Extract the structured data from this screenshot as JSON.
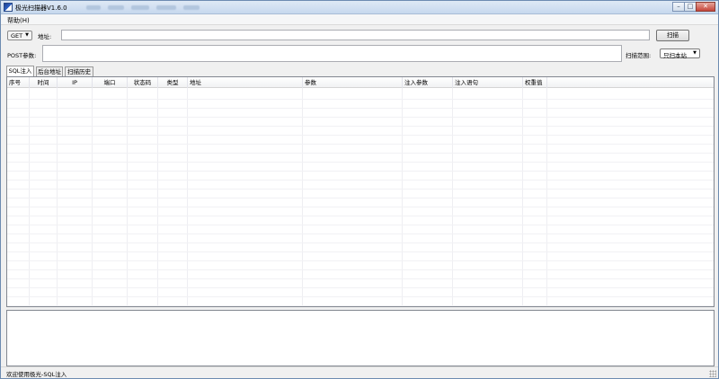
{
  "window": {
    "title": "极光扫描器V1.6.0",
    "controls": {
      "minimize": "–",
      "maximize": "□",
      "close": "✕"
    }
  },
  "menubar": {
    "items": [
      "帮助(H)"
    ]
  },
  "request": {
    "method": "GET",
    "url_label": "地址:",
    "url_value": "",
    "post_label": "POST参数:",
    "post_value": "",
    "scan_button": "扫描",
    "scope_label": "扫描范围:",
    "scope_value": "只扫本站"
  },
  "tabs": [
    {
      "label": "SQL注入",
      "active": true
    },
    {
      "label": "后台地址",
      "active": false
    },
    {
      "label": "扫描历史",
      "active": false
    }
  ],
  "table": {
    "columns": [
      "序号",
      "时间",
      "IP",
      "端口",
      "状态码",
      "类型",
      "地址",
      "参数",
      "注入参数",
      "注入语句",
      "权重值"
    ],
    "rows": []
  },
  "log": {
    "text": ""
  },
  "status": {
    "text": "欢迎使用极光-SQL注入"
  },
  "colors": {
    "window_border": "#6d8bb1",
    "titlebar": "#c6d8ee",
    "close_button": "#c5453a"
  },
  "icons": {
    "app": "app-logo-icon",
    "dropdown": "chevron-down-icon",
    "grip": "resize-grip-icon"
  }
}
